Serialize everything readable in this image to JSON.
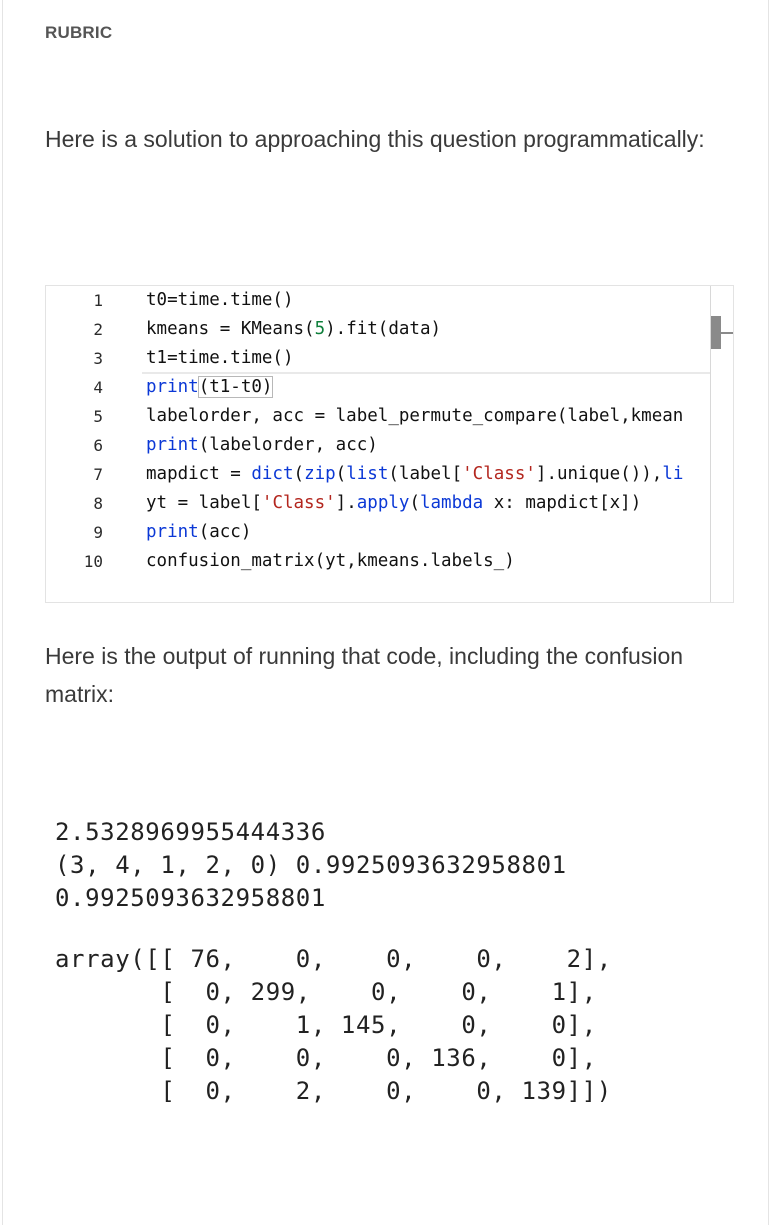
{
  "header": {
    "rubric_label": "RUBRIC"
  },
  "intro_text": "Here is a solution to approaching this question programmatically:",
  "code_editor": {
    "line_numbers": [
      "1",
      "2",
      "3",
      "4",
      "5",
      "6",
      "7",
      "8",
      "9",
      "10"
    ],
    "lines": [
      [
        {
          "t": "t0=time.time()",
          "c": ""
        }
      ],
      [
        {
          "t": "kmeans = KMeans(",
          "c": ""
        },
        {
          "t": "5",
          "c": "num"
        },
        {
          "t": ").fit(data)",
          "c": ""
        }
      ],
      [
        {
          "t": "t1=time.time()",
          "c": ""
        }
      ],
      [
        {
          "t": "print",
          "c": "kw"
        },
        {
          "t": "(t1-t0)",
          "c": "bracket"
        }
      ],
      [
        {
          "t": "labelorder, acc = label_permute_compare(label,kmean",
          "c": ""
        }
      ],
      [
        {
          "t": "print",
          "c": "kw"
        },
        {
          "t": "(labelorder, acc)",
          "c": ""
        }
      ],
      [
        {
          "t": "mapdict = ",
          "c": ""
        },
        {
          "t": "dict",
          "c": "kw"
        },
        {
          "t": "(",
          "c": ""
        },
        {
          "t": "zip",
          "c": "kw"
        },
        {
          "t": "(",
          "c": ""
        },
        {
          "t": "list",
          "c": "kw"
        },
        {
          "t": "(label[",
          "c": ""
        },
        {
          "t": "'Class'",
          "c": "str"
        },
        {
          "t": "].unique()),",
          "c": ""
        },
        {
          "t": "li",
          "c": "kw"
        }
      ],
      [
        {
          "t": "yt = label[",
          "c": ""
        },
        {
          "t": "'Class'",
          "c": "str"
        },
        {
          "t": "].",
          "c": ""
        },
        {
          "t": "apply",
          "c": "kw"
        },
        {
          "t": "(",
          "c": ""
        },
        {
          "t": "lambda",
          "c": "kw"
        },
        {
          "t": " x: mapdict[x])",
          "c": ""
        }
      ],
      [
        {
          "t": "print",
          "c": "kw"
        },
        {
          "t": "(acc)",
          "c": ""
        }
      ],
      [
        {
          "t": "confusion_matrix(yt,kmeans.labels_)",
          "c": ""
        }
      ]
    ]
  },
  "output_intro_text": "Here is the output of running that code, including the confusion matrix:",
  "output": {
    "line1": "2.5328969955444336",
    "line2": "(3, 4, 1, 2, 0) 0.9925093632958801",
    "line3": "0.9925093632958801",
    "array_lines": [
      "array([[ 76,    0,    0,    0,    2],",
      "       [  0, 299,    0,    0,    1],",
      "       [  0,    1, 145,    0,    0],",
      "       [  0,    0,    0, 136,    0],",
      "       [  0,    2,    0,    0, 139]])"
    ]
  },
  "colors": {
    "keyword": "#0b38d6",
    "string": "#b3261e",
    "number": "#0d7f3a",
    "text": "#3a3a3a"
  }
}
